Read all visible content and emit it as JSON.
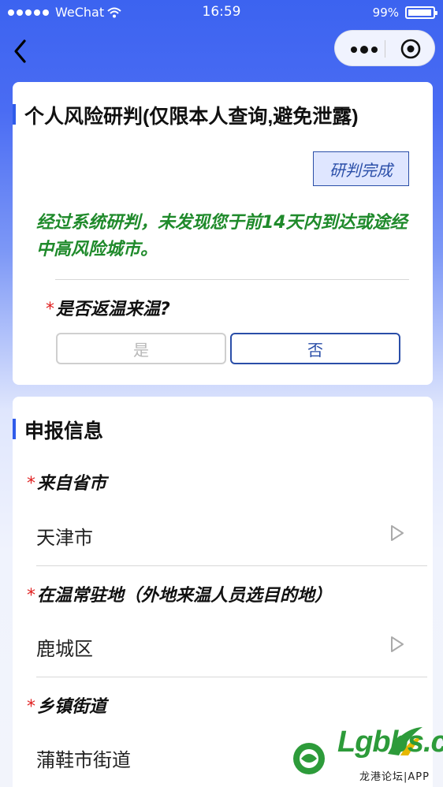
{
  "status_bar": {
    "carrier": "WeChat",
    "time": "16:59",
    "battery": "99%"
  },
  "nav": {
    "back_icon": "chevron-left-icon",
    "more_icon": "more-dots-icon",
    "close_icon": "target-icon"
  },
  "risk_card": {
    "title": "个人风险研判(仅限本人查询,避免泄露)",
    "badge": "研判完成",
    "result": "经过系统研判，未发现您于前14天内到达或途经中高风险城市。",
    "question": {
      "required_mark": "*",
      "label": "是否返温来温?",
      "options": [
        "是",
        "否"
      ],
      "selected": "否"
    }
  },
  "report_card": {
    "title": "申报信息",
    "fields": [
      {
        "required_mark": "*",
        "label": "来自省市",
        "value": "天津市"
      },
      {
        "required_mark": "*",
        "label": "在温常驻地（外地来温人员选目的地）",
        "value": "鹿城区"
      },
      {
        "required_mark": "*",
        "label": "乡镇街道",
        "value": "蒲鞋市街道"
      }
    ]
  },
  "watermark": {
    "text": "Lgbbs.cn",
    "subtext": "龙港论坛|APP"
  },
  "colors": {
    "accent": "#2f5bea",
    "success": "#1f8a2b",
    "required": "#e02020"
  }
}
